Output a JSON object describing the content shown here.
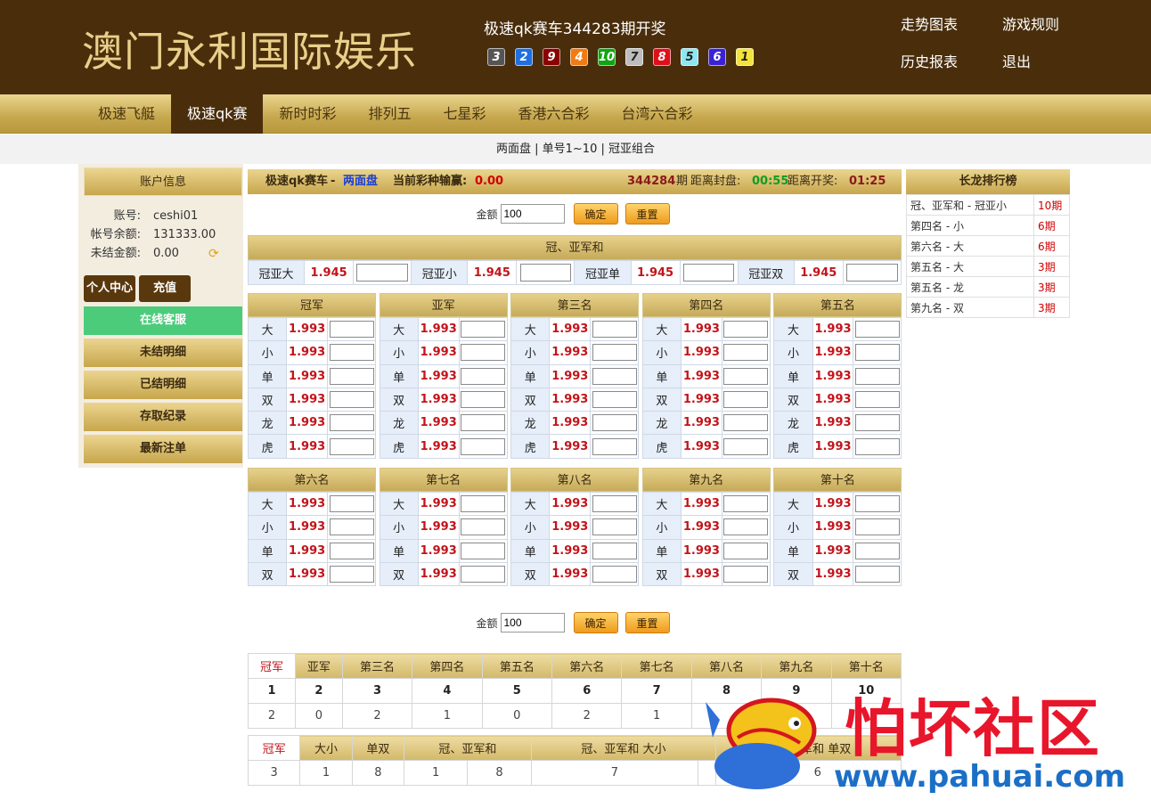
{
  "header": {
    "logo": "澳门永利国际娱乐",
    "draw_title": "极速qk赛车344283期开奖",
    "balls": [
      {
        "n": "3",
        "color": "#555555"
      },
      {
        "n": "2",
        "color": "#1f6fe0"
      },
      {
        "n": "9",
        "color": "#8b0000"
      },
      {
        "n": "4",
        "color": "#f07b14"
      },
      {
        "n": "10",
        "color": "#13a413"
      },
      {
        "n": "7",
        "color": "#bdbdbd"
      },
      {
        "n": "8",
        "color": "#e0101a"
      },
      {
        "n": "5",
        "color": "#8ee7f0"
      },
      {
        "n": "6",
        "color": "#3a22d4"
      },
      {
        "n": "1",
        "color": "#f4e33a"
      }
    ],
    "links": {
      "trend": "走势图表",
      "rules": "游戏规则",
      "history": "历史报表",
      "logout": "退出"
    }
  },
  "nav": {
    "tabs": [
      "极速飞艇",
      "极速qk赛",
      "新时时彩",
      "排列五",
      "七星彩",
      "香港六合彩",
      "台湾六合彩"
    ],
    "active": "极速qk赛"
  },
  "subnav": "两面盘 | 单号1~10 | 冠亚组合",
  "account": {
    "title": "账户信息",
    "rows": [
      {
        "label": "账号:",
        "value": "ceshi01"
      },
      {
        "label": "帐号余额:",
        "value": "131333.00"
      },
      {
        "label": "未结金额:",
        "value": "0.00"
      }
    ],
    "btn_personal": "个人中心",
    "btn_recharge": "充值",
    "menu": [
      "在线客服",
      "未结明细",
      "已结明细",
      "存取纪录",
      "最新注单"
    ]
  },
  "topbar": {
    "game": "极速qk赛车",
    "dash": "-",
    "mode": "两面盘",
    "winloss_label": "当前彩种输赢:",
    "winloss": "0.00",
    "period": "344284",
    "period_unit": "期",
    "close_label": "距离封盘:",
    "close_time": "00:55",
    "open_label": "距离开奖:",
    "open_time": "01:25"
  },
  "amount": {
    "label": "金额",
    "value": "100",
    "confirm": "确定",
    "reset": "重置"
  },
  "sum_section": {
    "title": "冠、亚军和",
    "items": [
      {
        "label": "冠亚大",
        "odds": "1.945"
      },
      {
        "label": "冠亚小",
        "odds": "1.945"
      },
      {
        "label": "冠亚单",
        "odds": "1.945"
      },
      {
        "label": "冠亚双",
        "odds": "1.945"
      }
    ]
  },
  "ranks_top": [
    {
      "title": "冠军",
      "rows": [
        [
          "大",
          "1.993"
        ],
        [
          "小",
          "1.993"
        ],
        [
          "单",
          "1.993"
        ],
        [
          "双",
          "1.993"
        ],
        [
          "龙",
          "1.993"
        ],
        [
          "虎",
          "1.993"
        ]
      ]
    },
    {
      "title": "亚军",
      "rows": [
        [
          "大",
          "1.993"
        ],
        [
          "小",
          "1.993"
        ],
        [
          "单",
          "1.993"
        ],
        [
          "双",
          "1.993"
        ],
        [
          "龙",
          "1.993"
        ],
        [
          "虎",
          "1.993"
        ]
      ]
    },
    {
      "title": "第三名",
      "rows": [
        [
          "大",
          "1.993"
        ],
        [
          "小",
          "1.993"
        ],
        [
          "单",
          "1.993"
        ],
        [
          "双",
          "1.993"
        ],
        [
          "龙",
          "1.993"
        ],
        [
          "虎",
          "1.993"
        ]
      ]
    },
    {
      "title": "第四名",
      "rows": [
        [
          "大",
          "1.993"
        ],
        [
          "小",
          "1.993"
        ],
        [
          "单",
          "1.993"
        ],
        [
          "双",
          "1.993"
        ],
        [
          "龙",
          "1.993"
        ],
        [
          "虎",
          "1.993"
        ]
      ]
    },
    {
      "title": "第五名",
      "rows": [
        [
          "大",
          "1.993"
        ],
        [
          "小",
          "1.993"
        ],
        [
          "单",
          "1.993"
        ],
        [
          "双",
          "1.993"
        ],
        [
          "龙",
          "1.993"
        ],
        [
          "虎",
          "1.993"
        ]
      ]
    }
  ],
  "ranks_bottom": [
    {
      "title": "第六名",
      "rows": [
        [
          "大",
          "1.993"
        ],
        [
          "小",
          "1.993"
        ],
        [
          "单",
          "1.993"
        ],
        [
          "双",
          "1.993"
        ]
      ]
    },
    {
      "title": "第七名",
      "rows": [
        [
          "大",
          "1.993"
        ],
        [
          "小",
          "1.993"
        ],
        [
          "单",
          "1.993"
        ],
        [
          "双",
          "1.993"
        ]
      ]
    },
    {
      "title": "第八名",
      "rows": [
        [
          "大",
          "1.993"
        ],
        [
          "小",
          "1.993"
        ],
        [
          "单",
          "1.993"
        ],
        [
          "双",
          "1.993"
        ]
      ]
    },
    {
      "title": "第九名",
      "rows": [
        [
          "大",
          "1.993"
        ],
        [
          "小",
          "1.993"
        ],
        [
          "单",
          "1.993"
        ],
        [
          "双",
          "1.993"
        ]
      ]
    },
    {
      "title": "第十名",
      "rows": [
        [
          "大",
          "1.993"
        ],
        [
          "小",
          "1.993"
        ],
        [
          "单",
          "1.993"
        ],
        [
          "双",
          "1.993"
        ]
      ]
    }
  ],
  "results": {
    "tabs": [
      "冠军",
      "亚军",
      "第三名",
      "第四名",
      "第五名",
      "第六名",
      "第七名",
      "第八名",
      "第九名",
      "第十名"
    ],
    "numbers": [
      "1",
      "2",
      "3",
      "4",
      "5",
      "6",
      "7",
      "8",
      "9",
      "10"
    ],
    "counts": [
      "2",
      "0",
      "2",
      "1",
      "0",
      "2",
      "1",
      "",
      "",
      ""
    ]
  },
  "results2": {
    "tabs": [
      "冠军",
      "大小",
      "单双",
      "冠、亚军和",
      "冠、亚军和 大小",
      "冠、亚军和 单双"
    ],
    "values": [
      "3",
      "1",
      "8",
      "1",
      "8",
      "7",
      "",
      "",
      "6"
    ]
  },
  "long_dragon": {
    "title": "长龙排行榜",
    "rows": [
      {
        "name": "冠、亚军和 - 冠亚小",
        "periods": "10期"
      },
      {
        "name": "第四名 - 小",
        "periods": "6期"
      },
      {
        "name": "第六名 - 大",
        "periods": "6期"
      },
      {
        "name": "第五名 - 大",
        "periods": "3期"
      },
      {
        "name": "第五名 - 龙",
        "periods": "3期"
      },
      {
        "name": "第九名 - 双",
        "periods": "3期"
      }
    ]
  },
  "watermark": {
    "text": "怕坏社区",
    "url": "www.pahuai.com"
  }
}
